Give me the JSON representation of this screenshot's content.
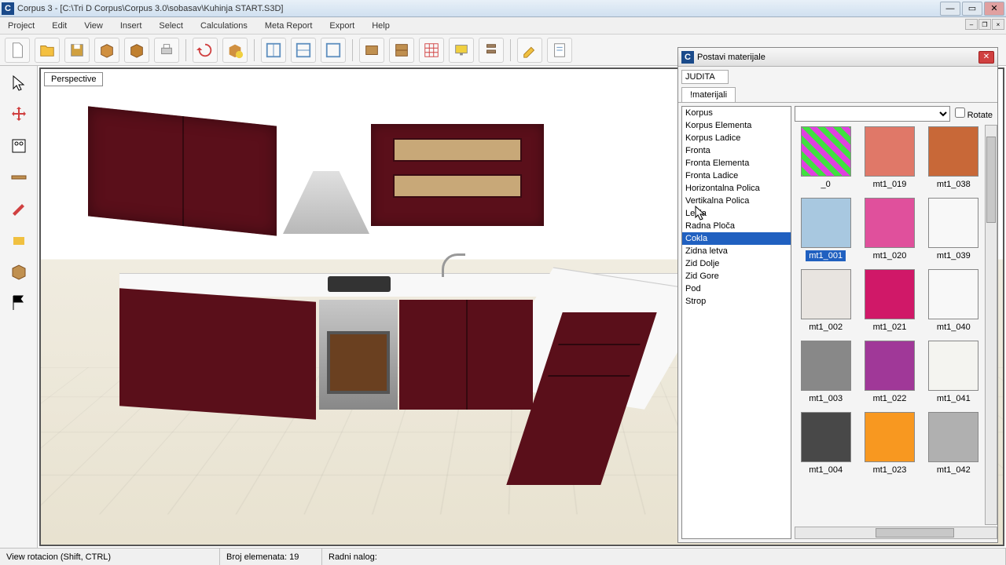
{
  "title": "Corpus 3  -  [C:\\Tri D Corpus\\Corpus 3.0\\sobasav\\Kuhinja START.S3D]",
  "menu": [
    "Project",
    "Edit",
    "View",
    "Insert",
    "Select",
    "Calculations",
    "Meta Report",
    "Export",
    "Help"
  ],
  "viewport_label": "Perspective",
  "panel": {
    "title": "Postavi materijale",
    "field_value": "JUDITA",
    "tab": "!materijali",
    "rotate_label": "Rotate",
    "elements": [
      "Korpus",
      "Korpus Elementa",
      "Korpus Ladice",
      "Fronta",
      "Fronta Elementa",
      "Fronta Ladice",
      "Horizontalna Polica",
      "Vertikalna Polica",
      "Ledja",
      "Radna Ploča",
      "Cokla",
      "Zidna letva",
      "Zid Dolje",
      "Zid Gore",
      "Pod",
      "Strop"
    ],
    "selected_element": "Cokla",
    "materials": [
      {
        "name": "_0",
        "color": "linear-gradient(45deg,#40e040 25%,#e040e0 25%,#e040e0 50%,#40e040 50%,#40e040 75%,#e040e0 75%)"
      },
      {
        "name": "mt1_019",
        "color": "#e07868"
      },
      {
        "name": "mt1_038",
        "color": "#c86838"
      },
      {
        "name": "mt1_001",
        "color": "#a8c8e0"
      },
      {
        "name": "mt1_020",
        "color": "#e0509c"
      },
      {
        "name": "mt1_039",
        "color": "#f8f8f8"
      },
      {
        "name": "mt1_002",
        "color": "#e8e4e0"
      },
      {
        "name": "mt1_021",
        "color": "#d01868"
      },
      {
        "name": "mt1_040",
        "color": "#f8f8f8"
      },
      {
        "name": "mt1_003",
        "color": "#888888"
      },
      {
        "name": "mt1_022",
        "color": "#a03898"
      },
      {
        "name": "mt1_041",
        "color": "#f4f4f0"
      },
      {
        "name": "mt1_004",
        "color": "#484848"
      },
      {
        "name": "mt1_023",
        "color": "#f89820"
      },
      {
        "name": "mt1_042",
        "color": "#b0b0b0"
      }
    ],
    "selected_material": "mt1_001"
  },
  "status": {
    "left": "View rotacion (Shift, CTRL)",
    "mid": "Broj elemenata: 19",
    "right": "Radni nalog:"
  }
}
